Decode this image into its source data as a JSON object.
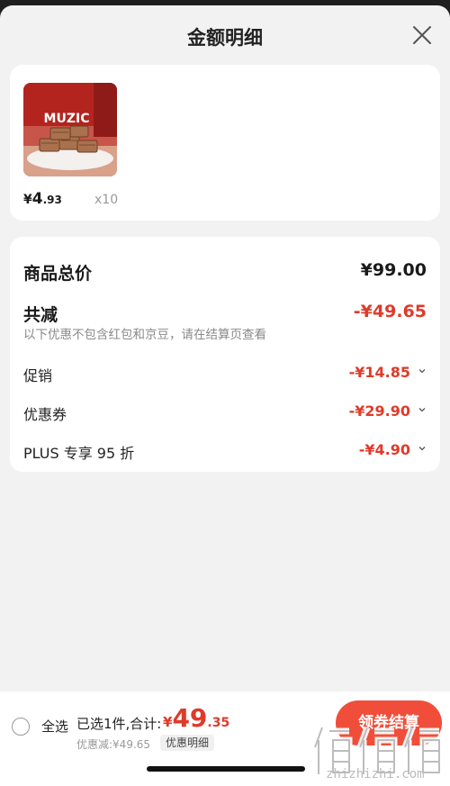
{
  "header": {
    "title": "金额明细"
  },
  "product": {
    "image_brand": "MUZIC",
    "price_symbol": "¥",
    "price_int": "4",
    "price_dec": ".93",
    "quantity": "x10"
  },
  "detail": {
    "total_label": "商品总价",
    "total_value": "¥99.00",
    "reduce_label": "共减",
    "reduce_value": "-¥49.65",
    "note": "以下优惠不包含红包和京豆，请在结算页查看",
    "items": [
      {
        "label": "促销",
        "value": "-¥14.85"
      },
      {
        "label": "优惠券",
        "value": "-¥29.90"
      },
      {
        "label": "PLUS 专享 95 折",
        "value": "-¥4.90"
      }
    ]
  },
  "bottom": {
    "select_all": "全选",
    "selected": "已选1件,合计:",
    "total_symbol": "¥",
    "total_int": "49",
    "total_dec": ".35",
    "discount_note": "优惠减:¥49.65",
    "detail_tag": "优惠明细",
    "checkout": "领券结算",
    "watermark_text": "zhizhizhi.com",
    "watermark_logo": "值 | 值 | 值"
  },
  "colors": {
    "accent": "#e03a2a",
    "button": "#f04e3a",
    "sheet_bg": "#f2f2f2"
  }
}
